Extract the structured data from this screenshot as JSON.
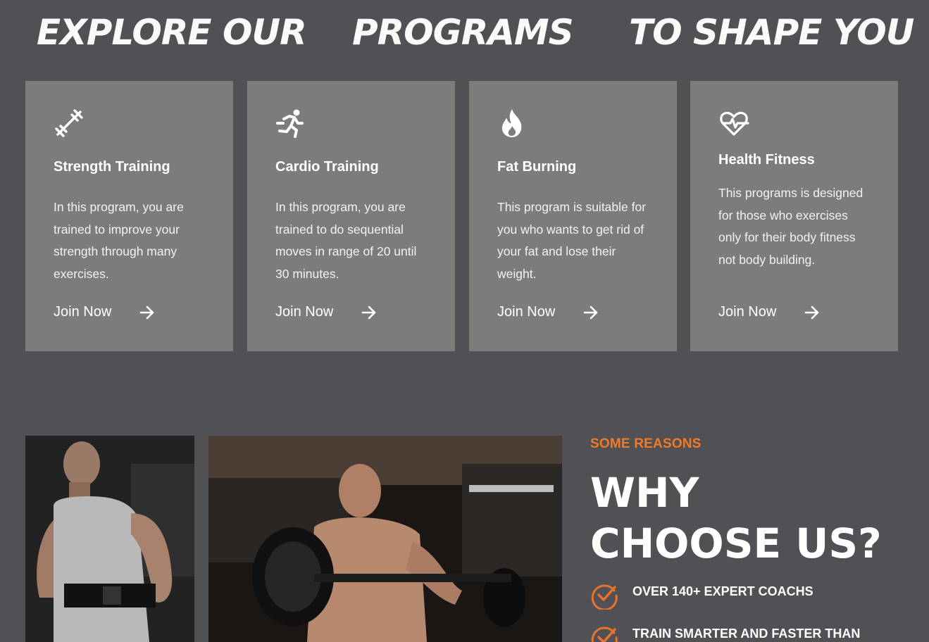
{
  "headline": {
    "word1": "EXPLORE OUR",
    "word2": "PROGRAMS",
    "word3": "TO SHAPE YOU"
  },
  "programs": [
    {
      "icon": "dumbbell-icon",
      "title": "Strength Training",
      "description": "In this program, you are trained to improve your strength through many exercises.",
      "link": "Join Now"
    },
    {
      "icon": "running-icon",
      "title": "Cardio Training",
      "description": "In this program, you are trained to do sequential moves in range of 20 until 30 minutes.",
      "link": "Join Now"
    },
    {
      "icon": "flame-icon",
      "title": "Fat Burning",
      "description": "This program is suitable for you who wants to get rid of your fat and lose their weight.",
      "link": "Join Now"
    },
    {
      "icon": "heart-pulse-icon",
      "title": "Health Fitness",
      "description": "This programs is designed for those who exercises only for their body fitness not body building.",
      "link": "Join Now"
    }
  ],
  "why": {
    "eyebrow": "SOME REASONS",
    "title": "WHY CHOOSE US?",
    "reasons": [
      "OVER 140+ EXPERT COACHS",
      "TRAIN SMARTER AND FASTER THAN"
    ]
  },
  "colors": {
    "background": "#515155",
    "card": "#7c7c7c",
    "accent": "#f07a28"
  }
}
